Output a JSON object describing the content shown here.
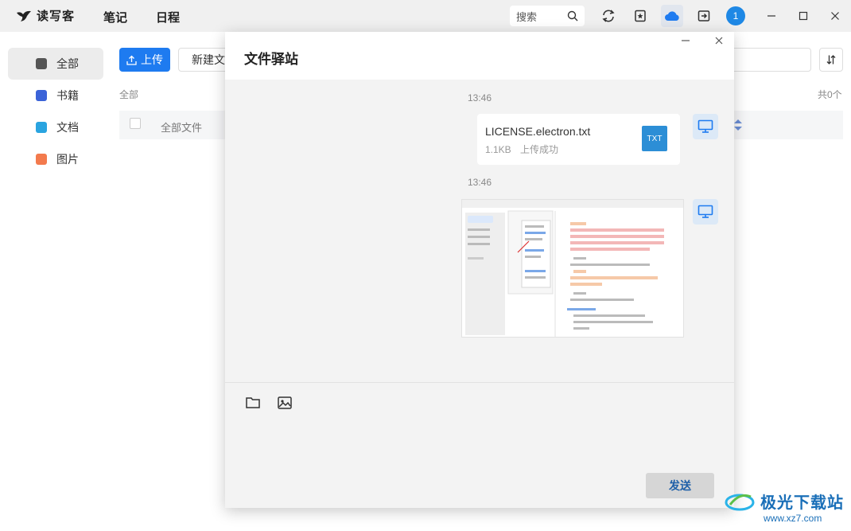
{
  "app": {
    "name": "读写客"
  },
  "nav": {
    "tabs": [
      "笔记",
      "日程"
    ]
  },
  "titlebar": {
    "search_placeholder": "搜索",
    "avatar_label": "1"
  },
  "sidebar": {
    "items": [
      {
        "label": "全部",
        "color": "#555555"
      },
      {
        "label": "书籍",
        "color": "#3b63d8"
      },
      {
        "label": "文档",
        "color": "#2aa4e0"
      },
      {
        "label": "图片",
        "color": "#f37a4d"
      }
    ]
  },
  "main": {
    "upload_label": "上传",
    "new_folder_label": "新建文件夹",
    "breadcrumb": "全部",
    "column_all_files": "全部文件",
    "total_count": "共0个"
  },
  "modal": {
    "title": "文件驿站",
    "messages": [
      {
        "time": "13:46",
        "file_name": "LICENSE.electron.txt",
        "file_size": "1.1KB",
        "status": "上传成功",
        "badge": "TXT"
      },
      {
        "time": "13:46"
      }
    ],
    "send_label": "发送"
  },
  "watermark": {
    "text": "极光下载站",
    "url": "www.xz7.com"
  }
}
